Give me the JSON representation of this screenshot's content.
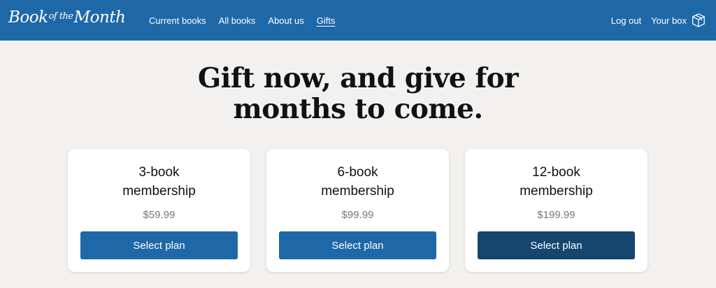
{
  "header": {
    "logo": {
      "part1": "Book",
      "part2": "of the",
      "part3": "Month"
    },
    "nav": [
      {
        "label": "Current books"
      },
      {
        "label": "All books"
      },
      {
        "label": "About us"
      },
      {
        "label": "Gifts",
        "active": true
      }
    ],
    "logout_label": "Log out",
    "box_label": "Your box",
    "box_icon": "box-icon"
  },
  "hero": {
    "line1": "Gift now, and give for",
    "line2": "months to come."
  },
  "plans": [
    {
      "title_line1": "3-book",
      "title_line2": "membership",
      "price": "$59.99",
      "button": "Select plan"
    },
    {
      "title_line1": "6-book",
      "title_line2": "membership",
      "price": "$99.99",
      "button": "Select plan"
    },
    {
      "title_line1": "12-book",
      "title_line2": "membership",
      "price": "$199.99",
      "button": "Select plan",
      "highlighted": true
    }
  ],
  "colors": {
    "nav_bg": "#1f68a8",
    "button": "#1f68a8",
    "button_hover": "#14466f",
    "page_bg": "#f2f1ef"
  }
}
